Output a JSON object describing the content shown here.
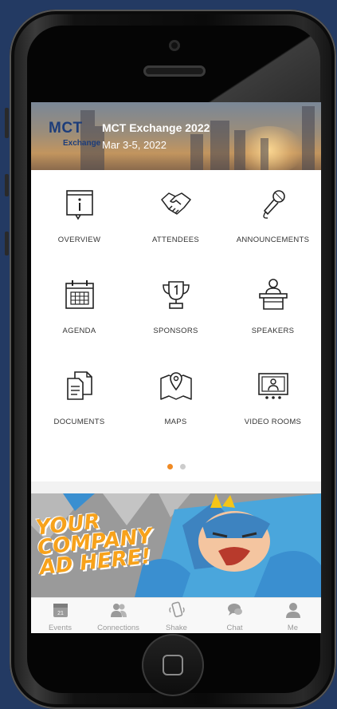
{
  "event": {
    "logo_main": "MCT",
    "logo_sub": "Exchange",
    "title": "MCT Exchange 2022",
    "dates": "Mar 3-5, 2022"
  },
  "menu": [
    {
      "label": "OVERVIEW",
      "icon": "info-icon"
    },
    {
      "label": "ATTENDEES",
      "icon": "handshake-icon"
    },
    {
      "label": "ANNOUNCEMENTS",
      "icon": "microphone-icon"
    },
    {
      "label": "AGENDA",
      "icon": "calendar-icon"
    },
    {
      "label": "SPONSORS",
      "icon": "trophy-icon"
    },
    {
      "label": "SPEAKERS",
      "icon": "podium-icon"
    },
    {
      "label": "DOCUMENTS",
      "icon": "documents-icon"
    },
    {
      "label": "MAPS",
      "icon": "map-icon"
    },
    {
      "label": "VIDEO ROOMS",
      "icon": "video-room-icon"
    }
  ],
  "pager": {
    "active_color": "#f08a24",
    "inactive_color": "#cccccc"
  },
  "ad": {
    "lines": [
      "YOUR",
      "COMPANY",
      "AD HERE!"
    ],
    "text_color": "#f7a21b"
  },
  "tabbar": {
    "items": [
      {
        "label": "Events",
        "icon": "calendar-icon",
        "badge": "21"
      },
      {
        "label": "Connections",
        "icon": "people-icon"
      },
      {
        "label": "Shake",
        "icon": "shake-phone-icon"
      },
      {
        "label": "Chat",
        "icon": "chat-bubbles-icon"
      },
      {
        "label": "Me",
        "icon": "person-icon"
      }
    ]
  }
}
